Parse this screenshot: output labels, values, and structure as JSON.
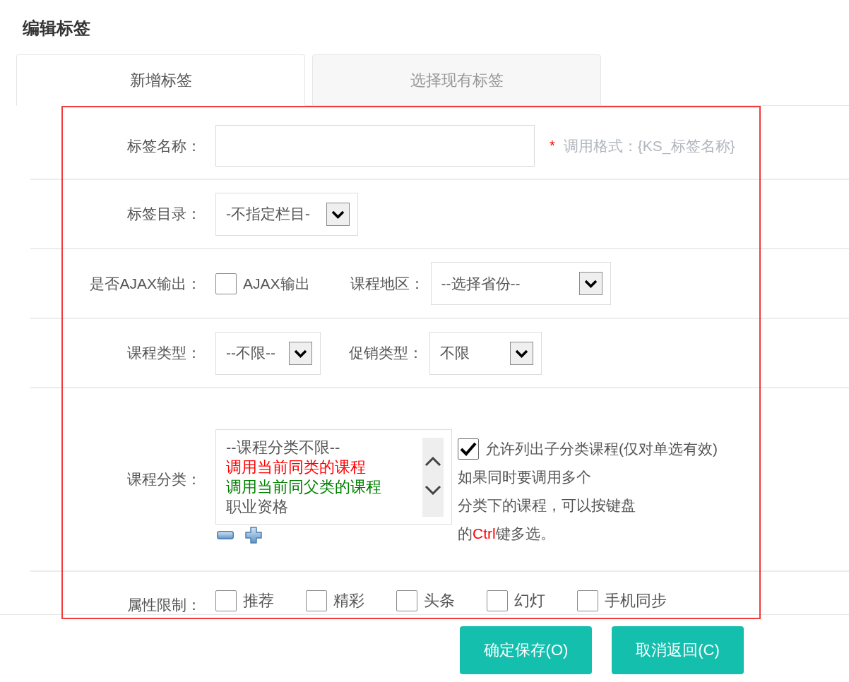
{
  "page": {
    "title": "编辑标签"
  },
  "tabs": [
    {
      "label": "新增标签",
      "selected": true
    },
    {
      "label": "选择现有标签",
      "selected": false
    }
  ],
  "form": {
    "name_row": {
      "label": "标签名称：",
      "required_mark": "*",
      "hint": "调用格式：{KS_标签名称}"
    },
    "directory_row": {
      "label": "标签目录：",
      "select": {
        "value": "-不指定栏目-"
      }
    },
    "ajax_row": {
      "label": "是否AJAX输出：",
      "checkbox": {
        "label": "AJAX输出",
        "checked": false
      },
      "region": {
        "label": "课程地区：",
        "select": {
          "value": "--选择省份--"
        }
      }
    },
    "type_row": {
      "label": "课程类型：",
      "select": {
        "value": "--不限--"
      },
      "promotion": {
        "label": "促销类型：",
        "select": {
          "value": "不限"
        }
      }
    },
    "category_row": {
      "label": "课程分类：",
      "listbox": {
        "items": [
          {
            "text": "--课程分类不限--",
            "color": "#555555"
          },
          {
            "text": "调用当前同类的课程",
            "color": "#ff0000"
          },
          {
            "text": "调用当前同父类的课程",
            "color": "#008000"
          },
          {
            "text": "职业资格",
            "color": "#555555"
          }
        ]
      },
      "include_children": {
        "label": "允许列出子分类课程(仅对单选有效)",
        "checked": true
      },
      "note": {
        "lines": [
          {
            "segments": [
              {
                "text": "如果同时要调用多个",
                "kind": "plain"
              }
            ]
          },
          {
            "segments": [
              {
                "text": "分类下的课程，可以按键盘",
                "kind": "plain"
              }
            ]
          },
          {
            "segments": [
              {
                "text": "的",
                "kind": "plain"
              },
              {
                "text": "Ctrl",
                "kind": "key"
              },
              {
                "text": "键多选。",
                "kind": "plain"
              }
            ]
          }
        ]
      }
    },
    "attributes_row": {
      "label": "属性限制：",
      "options": [
        {
          "label": "推荐",
          "checked": false
        },
        {
          "label": "精彩",
          "checked": false
        },
        {
          "label": "头条",
          "checked": false
        },
        {
          "label": "幻灯",
          "checked": false
        },
        {
          "label": "手机同步",
          "checked": false
        }
      ]
    }
  },
  "buttons": [
    {
      "label": "确定保存(O)"
    },
    {
      "label": "取消返回(C)"
    }
  ]
}
